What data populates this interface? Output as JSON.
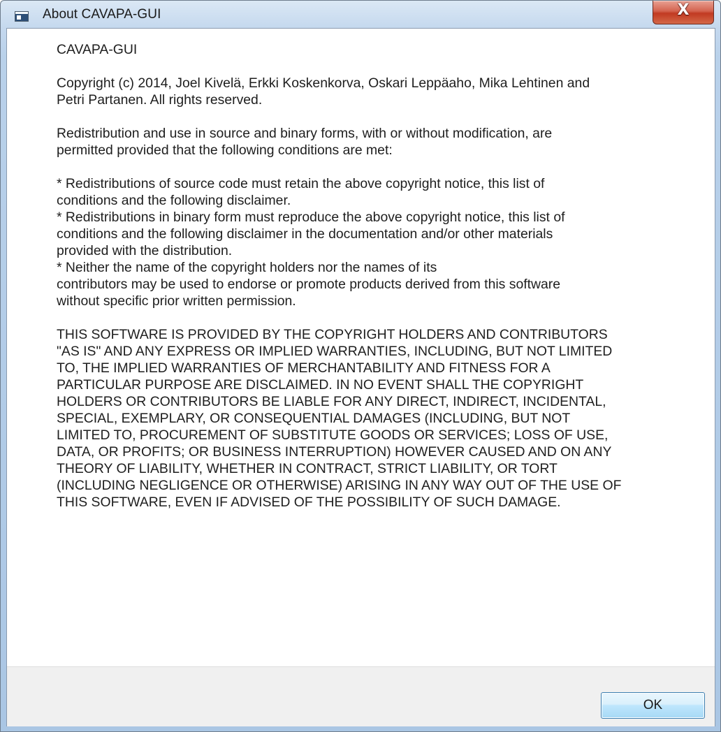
{
  "window": {
    "title": "About CAVAPA-GUI",
    "close_label": "X"
  },
  "content": {
    "app_name": "CAVAPA-GUI",
    "copyright": "Copyright (c) 2014, Joel Kivelä, Erkki Koskenkorva, Oskari Leppäaho, Mika Lehtinen and\nPetri Partanen. All rights reserved.",
    "redistribution": "Redistribution and use in source and binary forms, with or without modification, are\npermitted provided that the following conditions are met:",
    "conditions": "* Redistributions of source code must retain the above copyright notice, this list of\nconditions and the following disclaimer.\n* Redistributions in binary form must reproduce the above copyright notice, this list of\nconditions and the following disclaimer in the documentation and/or other materials\nprovided with the distribution.\n* Neither the name of the copyright holders nor the names of its\ncontributors may be used to endorse or promote products derived from this software\nwithout specific prior written permission.",
    "disclaimer": "THIS SOFTWARE IS PROVIDED BY THE COPYRIGHT HOLDERS AND CONTRIBUTORS\n\"AS IS\" AND ANY EXPRESS OR IMPLIED WARRANTIES, INCLUDING, BUT NOT LIMITED\nTO, THE IMPLIED WARRANTIES OF MERCHANTABILITY AND FITNESS FOR A\nPARTICULAR PURPOSE ARE DISCLAIMED. IN NO EVENT SHALL THE COPYRIGHT\nHOLDERS OR CONTRIBUTORS BE LIABLE FOR ANY DIRECT, INDIRECT, INCIDENTAL,\nSPECIAL, EXEMPLARY, OR CONSEQUENTIAL DAMAGES (INCLUDING, BUT NOT\nLIMITED TO, PROCUREMENT OF SUBSTITUTE GOODS OR SERVICES; LOSS OF USE,\nDATA, OR PROFITS; OR BUSINESS INTERRUPTION) HOWEVER CAUSED AND ON ANY\nTHEORY OF LIABILITY, WHETHER IN CONTRACT, STRICT LIABILITY, OR TORT\n(INCLUDING NEGLIGENCE OR OTHERWISE) ARISING IN ANY WAY OUT OF THE USE OF\nTHIS SOFTWARE, EVEN IF ADVISED OF THE POSSIBILITY OF SUCH DAMAGE."
  },
  "footer": {
    "ok_label": "OK"
  },
  "icons": {
    "app": "application-window-icon",
    "close": "close-icon"
  },
  "colors": {
    "close_button": "#c13a22",
    "ok_button_border": "#3c7fb1",
    "footer_bg": "#f0f0f0"
  }
}
